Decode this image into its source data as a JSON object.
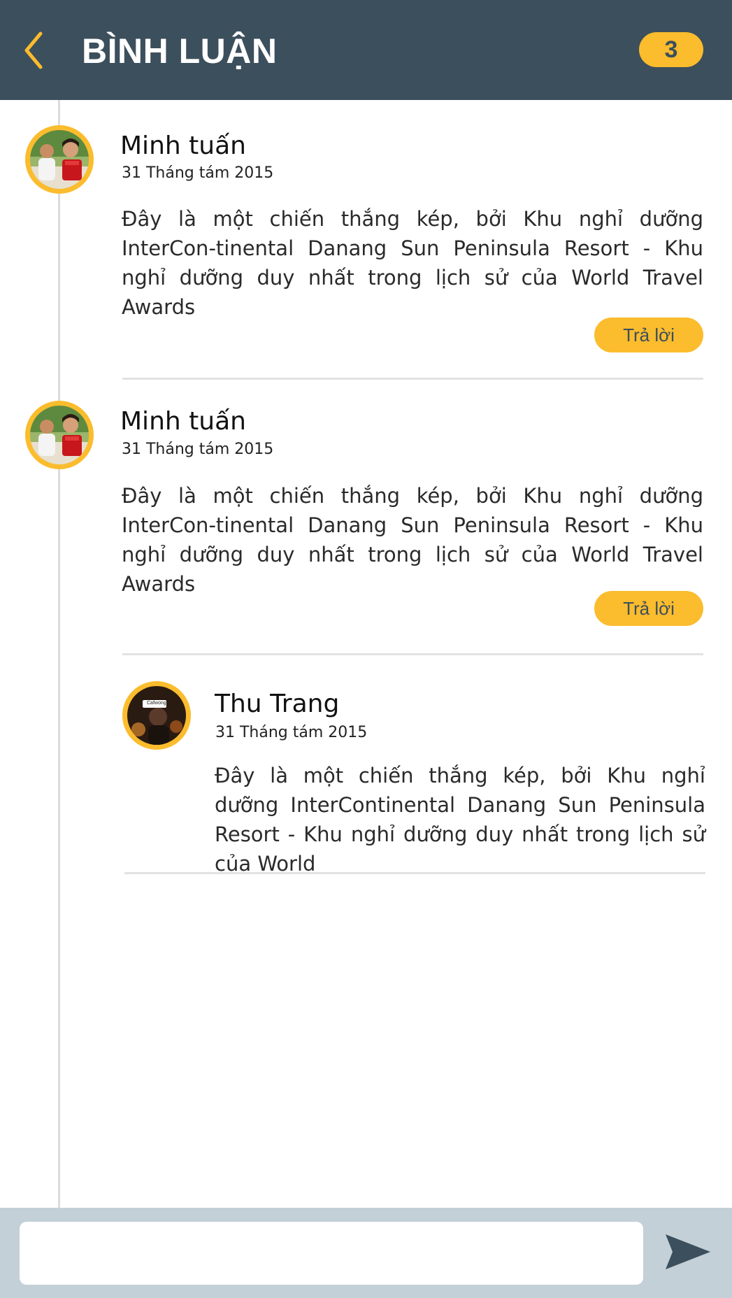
{
  "header": {
    "title": "BÌNH LUẬN",
    "count": "3",
    "back_icon": "chevron-left-icon"
  },
  "comments": [
    {
      "author": "Minh tuấn",
      "date": "31 Tháng tám 2015",
      "text": "Đây là một chiến thắng kép, bởi Khu nghỉ dưỡng InterCon-tinental Danang Sun Peninsula Resort - Khu nghỉ dưỡng duy nhất trong lịch sử của World Travel Awards",
      "reply_label": "Trả lời"
    },
    {
      "author": "Minh tuấn",
      "date": "31 Tháng tám 2015",
      "text": "Đây là một chiến thắng kép, bởi Khu nghỉ dưỡng InterCon-tinental Danang Sun Peninsula Resort - Khu nghỉ dưỡng duy nhất trong lịch sử của World Travel Awards",
      "reply_label": "Trả lời",
      "replies": [
        {
          "author": "Thu Trang",
          "date": "31 Tháng tám 2015",
          "text": "Đây là một chiến thắng kép, bởi Khu nghỉ dưỡng InterContinental Danang Sun Peninsula Resort - Khu nghỉ dưỡng duy nhất trong lịch sử của World",
          "avatar_caption": "Cafwong"
        }
      ]
    }
  ],
  "composer": {
    "value": "",
    "placeholder": "",
    "send_icon": "send-icon"
  },
  "colors": {
    "header_bg": "#3c4f5c",
    "accent": "#fbbc2d",
    "footer_bg": "#c3d0d7",
    "divider": "#e2e2e2"
  }
}
